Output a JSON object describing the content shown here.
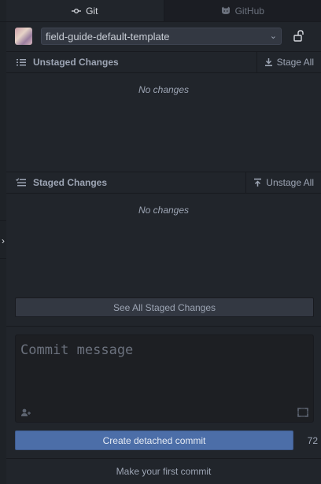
{
  "tabs": {
    "git": {
      "label": "Git",
      "icon": "git-commit-icon"
    },
    "github": {
      "label": "GitHub",
      "icon": "octocat-icon"
    }
  },
  "repo": {
    "selected": "field-guide-default-template",
    "lock_icon": "unlock-icon"
  },
  "unstaged": {
    "title": "Unstaged Changes",
    "action_label": "Stage All",
    "empty_text": "No changes",
    "icon": "list-unordered-icon"
  },
  "staged": {
    "title": "Staged Changes",
    "action_label": "Unstage All",
    "empty_text": "No changes",
    "icon": "tasklist-icon"
  },
  "footer": {
    "see_all_label": "See All Staged Changes",
    "commit_placeholder": "Commit message",
    "commit_button_label": "Create detached commit",
    "char_remaining": "72",
    "first_commit_label": "Make your first commit"
  },
  "colors": {
    "background": "#21252b",
    "commit_button": "#4c6ea8",
    "text": "#9da5b4"
  }
}
